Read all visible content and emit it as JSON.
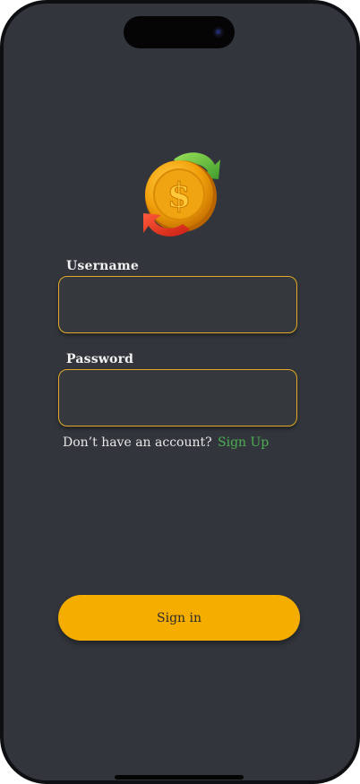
{
  "app": {
    "username_label": "Username",
    "username_value": "",
    "password_label": "Password",
    "password_value": "",
    "no_account_text": "Don’t have an account?",
    "signup_link": "Sign Up",
    "signin_button": "Sign in"
  },
  "colors": {
    "background": "#32363c",
    "accent": "#f5ae00",
    "field_border": "#e4a92a",
    "link": "#4caf50"
  },
  "icons": {
    "logo": "coin-exchange-icon"
  }
}
